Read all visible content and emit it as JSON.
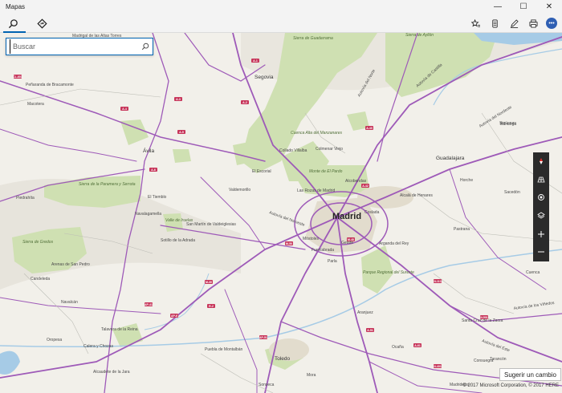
{
  "window": {
    "title": "Mapas"
  },
  "search": {
    "placeholder": "Buscar"
  },
  "icons": {
    "search_tab": "search-icon",
    "directions_tab": "directions-icon",
    "favorites": "star-list-icon",
    "collections": "collections-icon",
    "ink": "pen-icon",
    "print": "print-icon",
    "more": "more-icon",
    "location": "location-icon"
  },
  "suggest": {
    "label": "Sugerir un cambio"
  },
  "copyright": "© 2017 Microsoft Corporation, © 2017 HERE",
  "colors": {
    "accent": "#0063b1",
    "road": "#9e5ab8",
    "park": "#cfe0b2",
    "water": "#a6cbe6",
    "urban": "#e2dccd"
  },
  "places": [
    {
      "name": "Madrid",
      "size": "big"
    },
    {
      "name": "Segovia",
      "size": "mid"
    },
    {
      "name": "Ávila",
      "size": "mid"
    },
    {
      "name": "Toledo",
      "size": "mid"
    },
    {
      "name": "Guadalajara",
      "size": "mid"
    },
    {
      "name": "Alcalá de Henares",
      "size": "small"
    },
    {
      "name": "Fuenlabrada",
      "size": "small"
    },
    {
      "name": "Móstoles",
      "size": "small"
    },
    {
      "name": "Getafe",
      "size": "small"
    },
    {
      "name": "Parla",
      "size": "small"
    },
    {
      "name": "Coslada",
      "size": "small"
    },
    {
      "name": "Arganda del Rey",
      "size": "small"
    },
    {
      "name": "Aranjuez",
      "size": "small"
    },
    {
      "name": "Alcobendas",
      "size": "small"
    },
    {
      "name": "Las Rozas de Madrid",
      "size": "small"
    },
    {
      "name": "Collado Villalba",
      "size": "small"
    },
    {
      "name": "Colmenar Viejo",
      "size": "small"
    },
    {
      "name": "El Escorial",
      "size": "small"
    },
    {
      "name": "Valdemorillo",
      "size": "small"
    },
    {
      "name": "Navalagamella",
      "size": "small"
    },
    {
      "name": "Sigüenza",
      "size": "small"
    },
    {
      "name": "Madrigal de las Altas Torres",
      "size": "small"
    },
    {
      "name": "Peñaranda de Bracamonte",
      "size": "small"
    },
    {
      "name": "Macotera",
      "size": "small"
    },
    {
      "name": "Piedrahíta",
      "size": "small"
    },
    {
      "name": "El Tiemblo",
      "size": "small"
    },
    {
      "name": "San Martín de Valdeiglesias",
      "size": "small"
    },
    {
      "name": "Sotillo de la Adrada",
      "size": "small"
    },
    {
      "name": "Arenas de San Pedro",
      "size": "small"
    },
    {
      "name": "Candeleda",
      "size": "small"
    },
    {
      "name": "Talavera de la Reina",
      "size": "small"
    },
    {
      "name": "Navalcán",
      "size": "small"
    },
    {
      "name": "Oropesa",
      "size": "small"
    },
    {
      "name": "Calera y Chozas",
      "size": "small"
    },
    {
      "name": "Puebla de Montalbán",
      "size": "small"
    },
    {
      "name": "Mora",
      "size": "small"
    },
    {
      "name": "Ocaña",
      "size": "small"
    },
    {
      "name": "Tarancón",
      "size": "small"
    },
    {
      "name": "Brihuega",
      "size": "small"
    },
    {
      "name": "Sacedón",
      "size": "small"
    },
    {
      "name": "Pastrana",
      "size": "small"
    },
    {
      "name": "Horche",
      "size": "small"
    },
    {
      "name": "Madridejos",
      "size": "small"
    },
    {
      "name": "Consuegra",
      "size": "small"
    },
    {
      "name": "Alcaudete de la Jara",
      "size": "small"
    },
    {
      "name": "Santa Cruz de la Zarza",
      "size": "small"
    },
    {
      "name": "Sonseca",
      "size": "small"
    },
    {
      "name": "Cuenca",
      "size": "small"
    }
  ],
  "parks": [
    "Sierra de Guadarrama",
    "Sierra de la Paramera y Serrota",
    "Sierra de Gredos",
    "Cuenca Alta del Manzanares",
    "Monte de El Pardo",
    "Sierra de Ayllón",
    "Valle de Iruelas",
    "Parque Regional del Sureste"
  ],
  "roads": [
    "Autovía del Norte",
    "Autovía de Castilla",
    "Autovía del Noroeste",
    "Autovía del Nordeste",
    "Autovía de Andalucía",
    "Autovía del Este",
    "Autovía de Extremadura",
    "Autovía de los Viñedos",
    "Autovía de Toledo",
    "Autovía del Suroeste"
  ],
  "shields": [
    "A-1",
    "A-2",
    "A-3",
    "A-4",
    "A-5",
    "A-6",
    "A-40",
    "A-42",
    "M-40",
    "M-50",
    "M-30",
    "R-2",
    "AP-6",
    "AP-41",
    "AP-51",
    "A-51",
    "A-61",
    "N-501",
    "N-110",
    "N-403",
    "CL-601",
    "M-607",
    "A-43",
    "R-4",
    "R-3",
    "M-45",
    "A-31",
    "N-320"
  ]
}
